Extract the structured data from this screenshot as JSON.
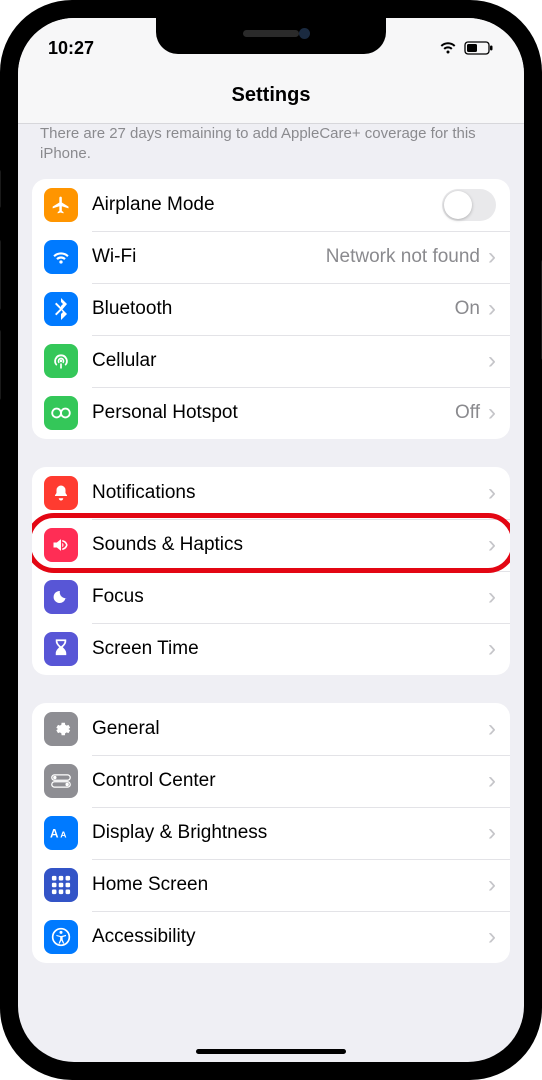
{
  "status": {
    "time": "10:27"
  },
  "header": {
    "title": "Settings"
  },
  "banner": {
    "text": "There are 27 days remaining to add AppleCare+ coverage for this iPhone."
  },
  "group1": {
    "airplane": {
      "label": "Airplane Mode",
      "icon": "#ff9500"
    },
    "wifi": {
      "label": "Wi-Fi",
      "value": "Network not found",
      "icon": "#007aff"
    },
    "bluetooth": {
      "label": "Bluetooth",
      "value": "On",
      "icon": "#007aff"
    },
    "cellular": {
      "label": "Cellular",
      "icon": "#34c759"
    },
    "hotspot": {
      "label": "Personal Hotspot",
      "value": "Off",
      "icon": "#34c759"
    }
  },
  "group2": {
    "notifications": {
      "label": "Notifications",
      "icon": "#ff3b30"
    },
    "sounds": {
      "label": "Sounds & Haptics",
      "icon": "#ff2d55"
    },
    "focus": {
      "label": "Focus",
      "icon": "#5856d6"
    },
    "screentime": {
      "label": "Screen Time",
      "icon": "#5856d6"
    }
  },
  "group3": {
    "general": {
      "label": "General",
      "icon": "#8e8e93"
    },
    "control": {
      "label": "Control Center",
      "icon": "#8e8e93"
    },
    "display": {
      "label": "Display & Brightness",
      "icon": "#007aff"
    },
    "home": {
      "label": "Home Screen",
      "icon": "#3354c7"
    },
    "accessibility": {
      "label": "Accessibility",
      "icon": "#007aff"
    }
  },
  "highlight": {
    "target": "sounds-haptics-row"
  }
}
